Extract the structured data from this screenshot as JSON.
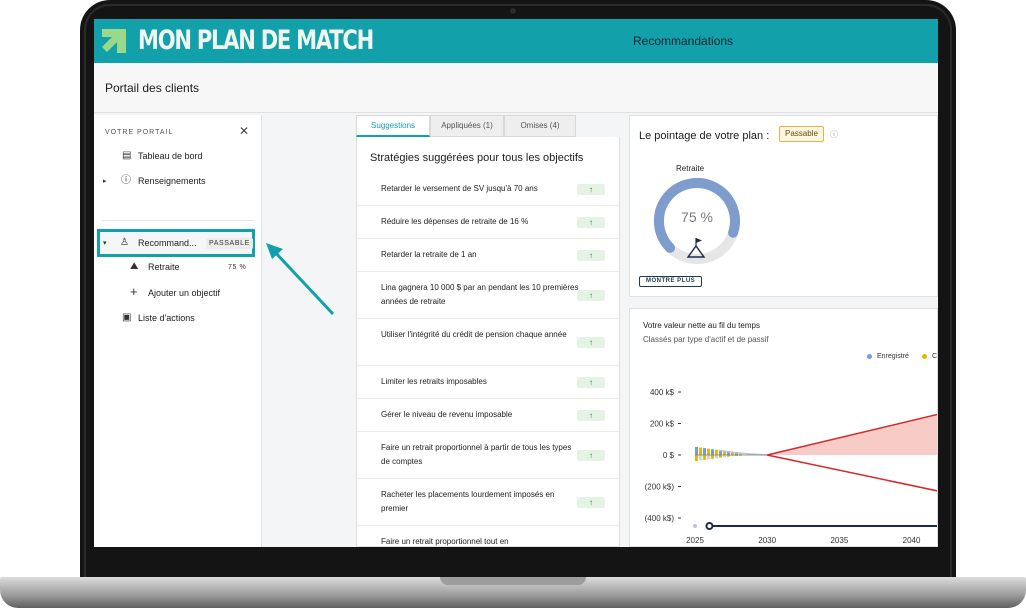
{
  "app": {
    "logo_text": "MON PLAN DE MATCH",
    "page_title": "Recommandations",
    "colors": {
      "primary": "#12a0aa",
      "logo_green": "#9ad98c",
      "navy": "#1a2b4e",
      "gauge": "#7e9ccc",
      "red": "#d22a2a",
      "legend_blue": "#6fa0d8",
      "legend_yellow": "#e6b800"
    }
  },
  "subheader": {
    "title": "Portail des clients"
  },
  "sidebar": {
    "heading": "VOTRE PORTAIL",
    "close_icon": "close-icon",
    "items": [
      {
        "label": "Tableau de bord",
        "icon": "dashboard-icon"
      },
      {
        "label": "Renseignements",
        "icon": "info-circle-icon"
      },
      {
        "label": "Recommand...",
        "icon": "recommendation-icon",
        "badge": "PASSABLE",
        "active": true
      },
      {
        "label": "Retraite",
        "icon": "mountain-flag-icon",
        "pct": "75 %"
      },
      {
        "label": "Ajouter un objectif",
        "icon": "plus-icon"
      },
      {
        "label": "Liste d'actions",
        "icon": "clipboard-icon"
      }
    ]
  },
  "tabs": [
    {
      "label": "Suggestions",
      "active": true
    },
    {
      "label": "Appliquées (1)"
    },
    {
      "label": "Omises (4)"
    }
  ],
  "strategies": {
    "title": "Stratégies suggérées pour tous les objectifs",
    "items": [
      {
        "label": "Retarder le versement de SV jusqu'à 70 ans",
        "indicator": "↑"
      },
      {
        "label": "Réduire les dépenses de retraite de 16 %",
        "indicator": "↑"
      },
      {
        "label": "Retarder la retraite de 1 an",
        "indicator": "↑"
      },
      {
        "label": "Lina gagnera 10 000 $ par an pendant les 10 premières années de retraite",
        "indicator": "↑"
      },
      {
        "label": "Utiliser l'intégrité du crédit de pension chaque année",
        "indicator": "↑"
      },
      {
        "label": "Limiter les retraits imposables",
        "indicator": "↑"
      },
      {
        "label": "Gérer le niveau de revenu imposable",
        "indicator": "↑"
      },
      {
        "label": "Faire un retrait proportionnel à partir de tous les types de comptes",
        "indicator": "↑"
      },
      {
        "label": "Racheter les placements lourdement imposés en premier",
        "indicator": "↑"
      },
      {
        "label": "Faire un retrait proportionnel tout en",
        "indicator": ""
      }
    ]
  },
  "score": {
    "title": "Le pointage de votre plan :",
    "badge": "Passable",
    "info_icon": "info-icon",
    "gauge_label": "Retraite",
    "gauge_value_text": "75 %",
    "gauge_fraction": 0.75,
    "button": "MONTRE PLUS"
  },
  "chart": {
    "title": "Votre valeur nette au fil du temps",
    "subtitle": "Classés par type d'actif et de passif",
    "legend": [
      {
        "name": "Enregistré",
        "color": "#6fa0d8"
      },
      {
        "name": "C",
        "color": "#e6b800"
      }
    ]
  },
  "chart_data": {
    "type": "area",
    "title": "Votre valeur nette au fil du temps",
    "subtitle": "Classés par type d'actif et de passif",
    "y_tick_labels": [
      "400 k$",
      "200 k$",
      "0 $",
      "(200 k$)",
      "(400 k$)"
    ],
    "y_ticks": [
      400,
      200,
      0,
      -200,
      -400
    ],
    "x_tick_labels": [
      "2025",
      "2030",
      "2035",
      "2040"
    ],
    "x_ticks": [
      2025,
      2030,
      2035,
      2040
    ],
    "xlim": [
      2025,
      2041.9
    ],
    "ylim": [
      -400,
      400
    ],
    "series": [
      {
        "name": "upper",
        "x": [
          2025,
          2030,
          2041.9
        ],
        "y": [
          60,
          0,
          260
        ]
      },
      {
        "name": "lower",
        "x": [
          2025,
          2030,
          2041.9
        ],
        "y": [
          60,
          0,
          -230
        ]
      }
    ]
  }
}
